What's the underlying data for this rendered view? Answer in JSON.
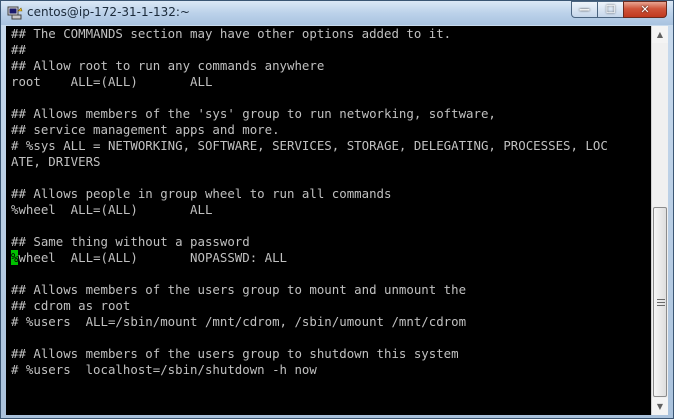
{
  "window": {
    "title": "centos@ip-172-31-1-132:~",
    "controls": {
      "minimize": "—",
      "maximize": "☐",
      "close": "✕"
    }
  },
  "terminal": {
    "lines": [
      "## The COMMANDS section may have other options added to it.",
      "##",
      "## Allow root to run any commands anywhere",
      "root    ALL=(ALL)       ALL",
      "",
      "## Allows members of the 'sys' group to run networking, software,",
      "## service management apps and more.",
      "# %sys ALL = NETWORKING, SOFTWARE, SERVICES, STORAGE, DELEGATING, PROCESSES, LOC",
      "ATE, DRIVERS",
      "",
      "## Allows people in group wheel to run all commands",
      "%wheel  ALL=(ALL)       ALL",
      "",
      "## Same thing without a password",
      "wheel  ALL=(ALL)       NOPASSWD: ALL",
      "",
      "## Allows members of the users group to mount and unmount the",
      "## cdrom as root",
      "# %users  ALL=/sbin/mount /mnt/cdrom, /sbin/umount /mnt/cdrom",
      "",
      "## Allows members of the users group to shutdown this system",
      "# %users  localhost=/sbin/shutdown -h now"
    ],
    "cursor_char": "%",
    "colors": {
      "background": "#000000",
      "text": "#c0c0c0",
      "cursor": "#00c000"
    }
  },
  "scrollbar": {
    "up_arrow": "▲",
    "down_arrow": "▼",
    "position": 0.6
  }
}
